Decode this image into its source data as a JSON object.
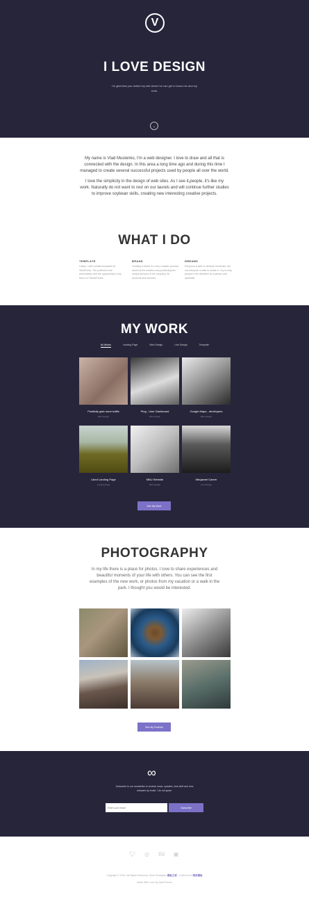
{
  "hero": {
    "logo_letter": "V",
    "title": "I LOVE DESIGN",
    "subtitle": "I'm glad that you visited my site where he can get to know me and my work.",
    "scroll_icon": "chevron-down-icon"
  },
  "about": {
    "paragraph1": "My name is Vlad Muslenko, I'm a web designer. I love to draw and all that is connected with the design. In this area a long time ago and during this time I managed to create several successful projects used by people all over the world.",
    "paragraph2": "I love the simplicity in the design of web sites. As I see it,people, it's like my work. Naturally do not want to rest on our laurels and will continue further studies to improve soybean skills, creating new interesting creative projects."
  },
  "services": {
    "title": "WHAT I DO",
    "items": [
      {
        "title": "TEMPLATE",
        "text": "Lately, I often create templates for WordPress. The portfolio is the presentation and the opportunity to buy them on ThemeForest."
      },
      {
        "title": "BRAND",
        "text": "Creating a brand is a very complex process aimed at the creation and positioning the unique persona of the company, its products and services."
      },
      {
        "title": "DREAMS",
        "text": "Everyone is able to develop his dream, but not everyone is able to create it. I try to help people in the definition as a person and specialist."
      }
    ]
  },
  "work": {
    "title": "MY WORK",
    "filters": [
      "All Works",
      "Landing Page",
      "Web Design",
      "Line Design",
      "Template"
    ],
    "cards": [
      {
        "title": "Positivity gain more traffic",
        "category": "Web Design"
      },
      {
        "title": "Plug - User Dashboard",
        "category": "Web Design"
      },
      {
        "title": "Google Maps - developers",
        "category": "Web Design"
      },
      {
        "title": "Liked Landing Page",
        "category": "Landing Page"
      },
      {
        "title": "MBU Website",
        "category": "Web Design"
      },
      {
        "title": "Mbujamel Career",
        "category": "Line Design"
      }
    ],
    "button_label": "See My Work"
  },
  "photography": {
    "title": "PHOTOGRAPHY",
    "text": "In my life there is a place for photos. I love to share experiences and beautiful moments of your life with others. You can see the first examples of the new work, or photos from my vacation or a walk in the park. I thought you would be interested.",
    "button_label": "See My Portfolio"
  },
  "newsletter": {
    "icon": "infinity-icon",
    "text": "Subscribe to our newsletter to receive news, updates, free stuff and new releases by email. I do not spam.",
    "email_placeholder": "Enter your email",
    "button_label": "Subscribe"
  },
  "footer": {
    "social_icons": [
      "twitter-icon",
      "dribbble-icon",
      "behance-icon",
      "instagram-icon"
    ],
    "copyright_prefix": "Copyright © 2016. All Rights Reserved. More Templates",
    "brand1": "模板之家",
    "collect_label": "- Collect from",
    "brand2": "网页模板",
    "made_with": "Made With Love By QuitoTheme"
  }
}
